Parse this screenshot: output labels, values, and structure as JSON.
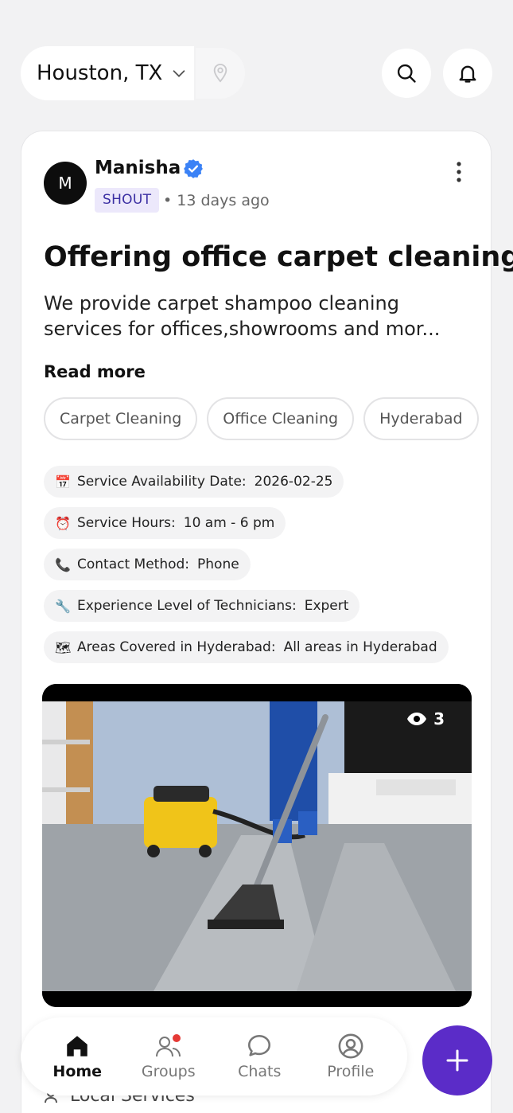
{
  "header": {
    "location": "Houston, TX"
  },
  "post": {
    "author": {
      "initial": "M",
      "name": "Manisha",
      "verified": true
    },
    "badge": "SHOUT",
    "time_ago": "• 13 days ago",
    "title": "Offering office carpet cleaning",
    "description": "We provide carpet shampoo cleaning services for offices,showrooms and mor...",
    "read_more": "Read more",
    "tags": [
      "Carpet Cleaning",
      "Office Cleaning",
      "Hyderabad"
    ],
    "attributes": [
      {
        "icon": "📅",
        "label": "Service Availability Date:",
        "value": "2026-02-25"
      },
      {
        "icon": "⏰",
        "label": "Service Hours:",
        "value": "10 am - 6 pm"
      },
      {
        "icon": "📞",
        "label": "Contact Method:",
        "value": "Phone"
      },
      {
        "icon": "🔧",
        "label": "Experience Level of Technicians:",
        "value": "Expert"
      },
      {
        "icon": "🗺",
        "label": "Areas Covered in Hyderabad:",
        "value": "All areas in Hyderabad"
      }
    ],
    "media": {
      "views": "3"
    }
  },
  "bottom_nav": {
    "items": [
      {
        "label": "Home",
        "active": true
      },
      {
        "label": "Groups",
        "active": false,
        "notification_dot": true
      },
      {
        "label": "Chats",
        "active": false
      },
      {
        "label": "Profile",
        "active": false
      }
    ]
  },
  "behind_nav_text": "Local Services",
  "colors": {
    "accent": "#5b2cc8",
    "badge_bg": "#ece8fb",
    "verified": "#3b82f6",
    "notification": "#e53935"
  }
}
